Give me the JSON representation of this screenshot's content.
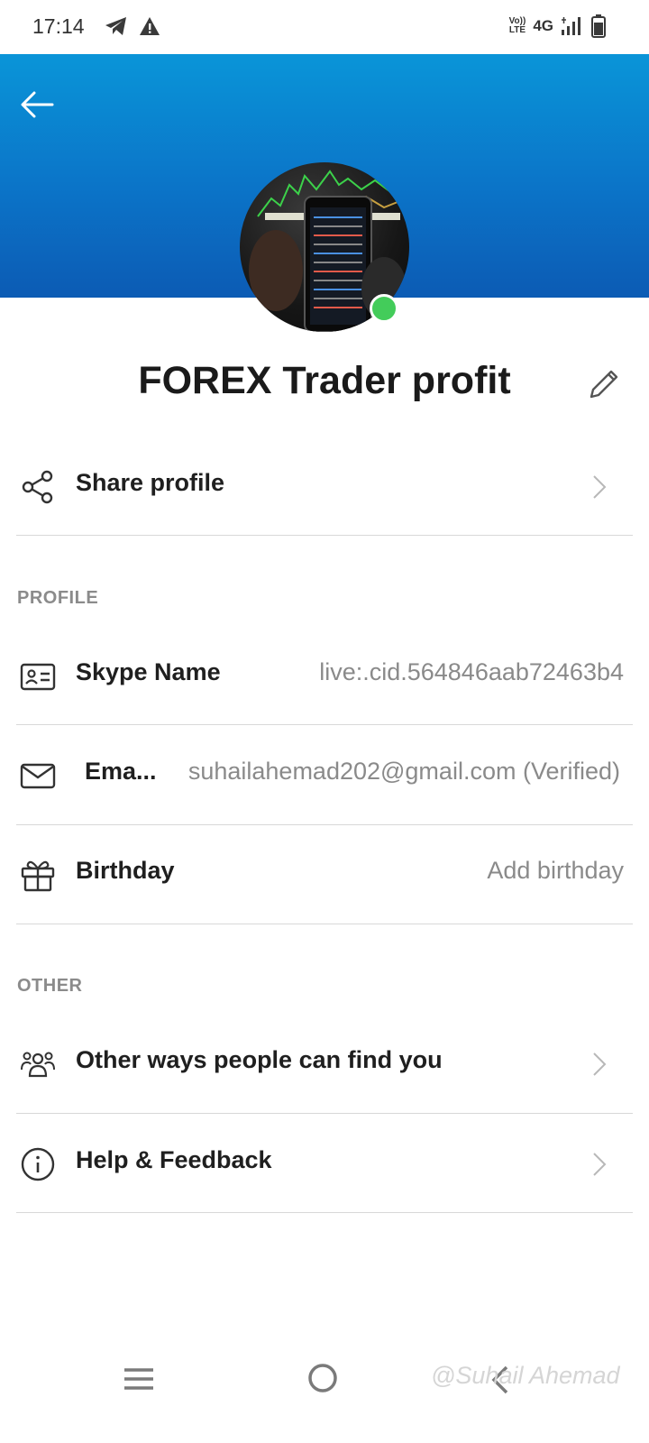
{
  "status_bar": {
    "time": "17:14",
    "left_icons": [
      "telegram-icon",
      "warning-icon"
    ],
    "volte_top": "Vo))",
    "volte_bottom": "LTE",
    "network": "4G",
    "right_icons": [
      "signal-icon",
      "battery-icon"
    ]
  },
  "header": {
    "back_icon": "back-arrow-icon",
    "gradient_top": "#0a95d8",
    "gradient_bottom": "#0c5bb4"
  },
  "profile": {
    "name": "FOREX Trader profit",
    "presence_color": "#43cc5a",
    "edit_icon": "pencil-icon"
  },
  "share_row": {
    "icon": "share-icon",
    "label": "Share profile"
  },
  "profile_section": {
    "title": "PROFILE",
    "rows": [
      {
        "icon": "id-card-icon",
        "label": "Skype Name",
        "value": "live:.cid.564846aab72463b4"
      },
      {
        "icon": "mail-icon",
        "label": "Ema...",
        "value": "suhailahemad202@gmail.com (Verified)"
      },
      {
        "icon": "gift-icon",
        "label": "Birthday",
        "value": "Add birthday"
      }
    ]
  },
  "other_section": {
    "title": "OTHER",
    "rows": [
      {
        "icon": "people-icon",
        "label": "Other ways people can find you"
      },
      {
        "icon": "info-icon",
        "label": "Help & Feedback"
      }
    ]
  },
  "nav_bar": {
    "icons": [
      "menu-icon",
      "home-circle-icon",
      "back-chevron-icon"
    ],
    "watermark": "@Suhail Ahemad"
  }
}
